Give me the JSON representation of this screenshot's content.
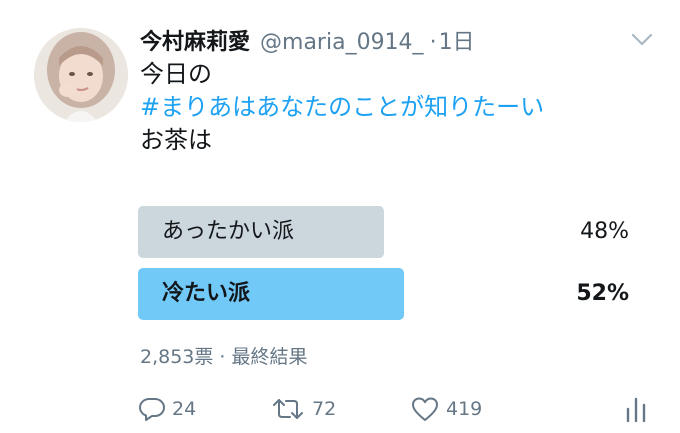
{
  "tweet": {
    "display_name": "今村麻莉愛",
    "handle": "@maria_0914_",
    "separator": "·",
    "time": "1日",
    "lines": [
      "今日の",
      "#まりあはあなたのことが知りたーい",
      "お茶は"
    ]
  },
  "poll": {
    "options": [
      {
        "label": "あったかい派",
        "percent_text": "48%",
        "percent": 48,
        "winner": false
      },
      {
        "label": "冷たい派",
        "percent_text": "52%",
        "percent": 52,
        "winner": true
      }
    ],
    "meta": "2,853票 · 最終結果"
  },
  "actions": {
    "reply_count": "24",
    "retweet_count": "72",
    "like_count": "419"
  },
  "colors": {
    "hashtag": "#1da1f2",
    "winner_bar": "#71c9f8",
    "loser_bar": "#ccd6dd",
    "muted_text": "#657786"
  },
  "icons": [
    "caret-down-icon",
    "reply-icon",
    "retweet-icon",
    "like-icon",
    "analytics-icon"
  ]
}
